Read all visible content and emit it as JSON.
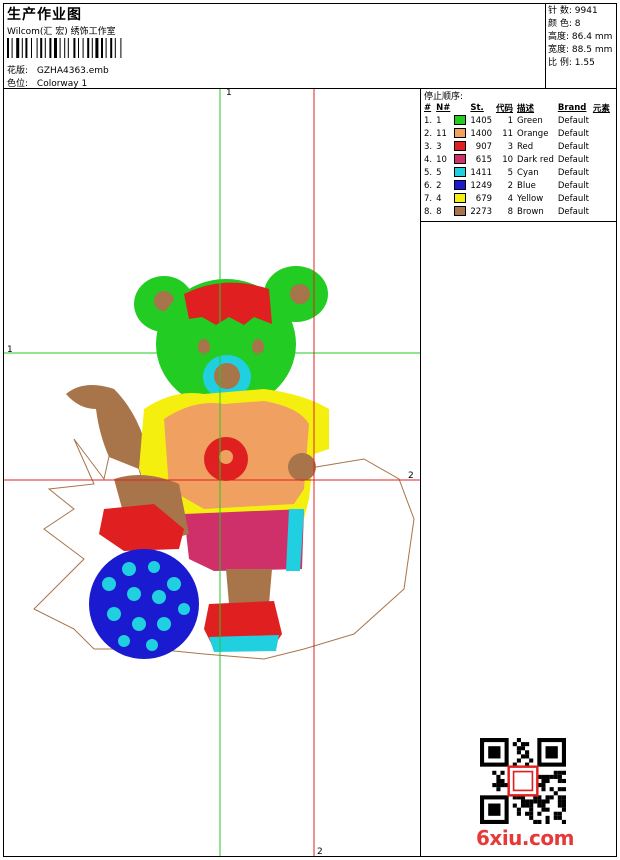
{
  "header": {
    "title": "生产作业图",
    "company": "Wilcom(汇 宏) 绣饰工作室",
    "design_label": "花版:",
    "design_value": "GZHA4363.emb",
    "colorway_label": "色位:",
    "colorway_value": "Colorway 1"
  },
  "stats": {
    "stitches_label": "针 数:",
    "stitches": "9941",
    "colors_label": "颜 色:",
    "colors": "8",
    "height_label": "高度:",
    "height": "86.4 mm",
    "width_label": "宽度:",
    "width": "88.5 mm",
    "scale_label": "比 例:",
    "scale": "1.55"
  },
  "stop_sequence": {
    "title": "停止顺序:",
    "headers": [
      "#",
      "N#",
      "",
      "St.",
      "代码",
      "描述",
      "Brand",
      "元素"
    ],
    "rows": [
      {
        "order": "1.",
        "n": "1",
        "color": "#22cc22",
        "stitches": "1405",
        "code": "1",
        "desc": "Green",
        "brand": "Default"
      },
      {
        "order": "2.",
        "n": "11",
        "color": "#f0a060",
        "stitches": "1400",
        "code": "11",
        "desc": "Orange",
        "brand": "Default"
      },
      {
        "order": "3.",
        "n": "3",
        "color": "#e02020",
        "stitches": "907",
        "code": "3",
        "desc": "Red",
        "brand": "Default"
      },
      {
        "order": "4.",
        "n": "10",
        "color": "#d0306a",
        "stitches": "615",
        "code": "10",
        "desc": "Dark red",
        "brand": "Default"
      },
      {
        "order": "5.",
        "n": "5",
        "color": "#20d0e0",
        "stitches": "1411",
        "code": "5",
        "desc": "Cyan",
        "brand": "Default"
      },
      {
        "order": "6.",
        "n": "2",
        "color": "#1a1ad0",
        "stitches": "1249",
        "code": "2",
        "desc": "Blue",
        "brand": "Default"
      },
      {
        "order": "7.",
        "n": "4",
        "color": "#f5ef10",
        "stitches": "679",
        "code": "4",
        "desc": "Yellow",
        "brand": "Default"
      },
      {
        "order": "8.",
        "n": "8",
        "color": "#a8744a",
        "stitches": "2273",
        "code": "8",
        "desc": "Brown",
        "brand": "Default"
      }
    ]
  },
  "guides": {
    "green_top": "1",
    "green_left": "1",
    "red_right": "2",
    "red_bottom": "2"
  },
  "watermark": "6xiu.com"
}
